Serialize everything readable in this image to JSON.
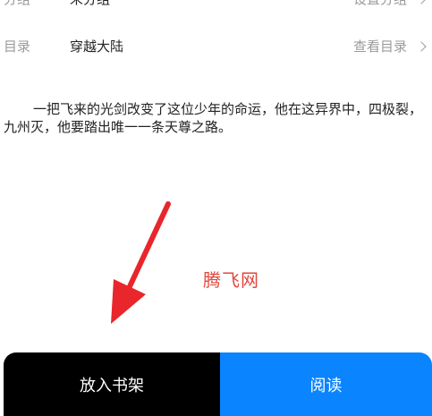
{
  "info": {
    "group": {
      "label": "分组",
      "value": "未分组",
      "action": "设置分组"
    },
    "catalog": {
      "label": "目录",
      "value": "穿越大陆",
      "action": "查看目录"
    }
  },
  "description": "一把飞来的光剑改变了这位少年的命运，他在这异界中，四极裂，九州灭，他要踏出唯一一条天尊之路。",
  "watermark": "腾飞网",
  "annotation": {
    "color": "#e8262b"
  },
  "bottom_bar": {
    "add_to_shelf_label": "放入书架",
    "read_label": "阅读",
    "shelf_color": "#000000",
    "read_color": "#0a84ff"
  }
}
